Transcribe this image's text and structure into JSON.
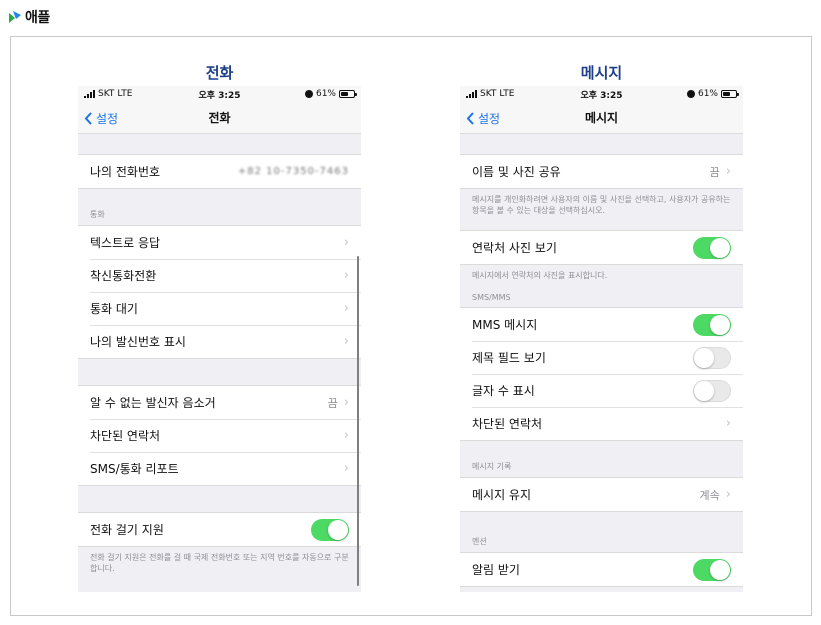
{
  "brand": {
    "text": "애플"
  },
  "left": {
    "title": "전화",
    "status": {
      "carrier": "SKT",
      "network": "LTE",
      "time": "오후 3:25",
      "battery": "61%"
    },
    "nav": {
      "back": "설정",
      "title": "전화"
    },
    "my_number": {
      "label": "나의 전화번호",
      "value": "+82 10-7350-7463"
    },
    "calls_section": "통화",
    "calls": [
      "텍스트로 응답",
      "착신통화전환",
      "통화 대기",
      "나의 발신번호 표시"
    ],
    "group3": [
      {
        "label": "알 수 없는 발신자 음소거",
        "value": "끔"
      },
      {
        "label": "차단된 연락처",
        "value": ""
      },
      {
        "label": "SMS/통화 리포트",
        "value": ""
      }
    ],
    "dial_assist": {
      "label": "전화 걸기 지원",
      "on": true,
      "note": "전화 걸기 지원은 전화를 걸 때 국제 전화번호 또는 지역 번호를 자동으로 구분합니다."
    }
  },
  "right": {
    "title": "메시지",
    "status": {
      "carrier": "SKT",
      "network": "LTE",
      "time": "오후 3:25",
      "battery": "61%"
    },
    "nav": {
      "back": "설정",
      "title": "메시지"
    },
    "name_photo": {
      "label": "이름 및 사진 공유",
      "value": "끔",
      "note": "메시지를 개인화하려면 사용자의 이름 및 사진을 선택하고, 사용자가 공유하는 항목을 볼 수 있는 대상을 선택하십시오."
    },
    "contact_photo": {
      "label": "연락처 사진 보기",
      "on": true,
      "note": "메시지에서 연락처의 사진을 표시합니다."
    },
    "sms_section": "SMS/MMS",
    "mms": [
      {
        "label": "MMS 메시지",
        "on": true
      },
      {
        "label": "제목 필드 보기",
        "on": false
      },
      {
        "label": "글자 수 표시",
        "on": false
      }
    ],
    "blocked": {
      "label": "차단된 연락처"
    },
    "history_section": "메시지 기록",
    "keep": {
      "label": "메시지 유지",
      "value": "계속"
    },
    "mentions_section": "멘션",
    "notify": {
      "label": "알림 받기",
      "on": true
    }
  },
  "colors": {
    "accent": "#1a73e8",
    "toggle_on": "#4cd964",
    "title": "#1f3f8a"
  }
}
